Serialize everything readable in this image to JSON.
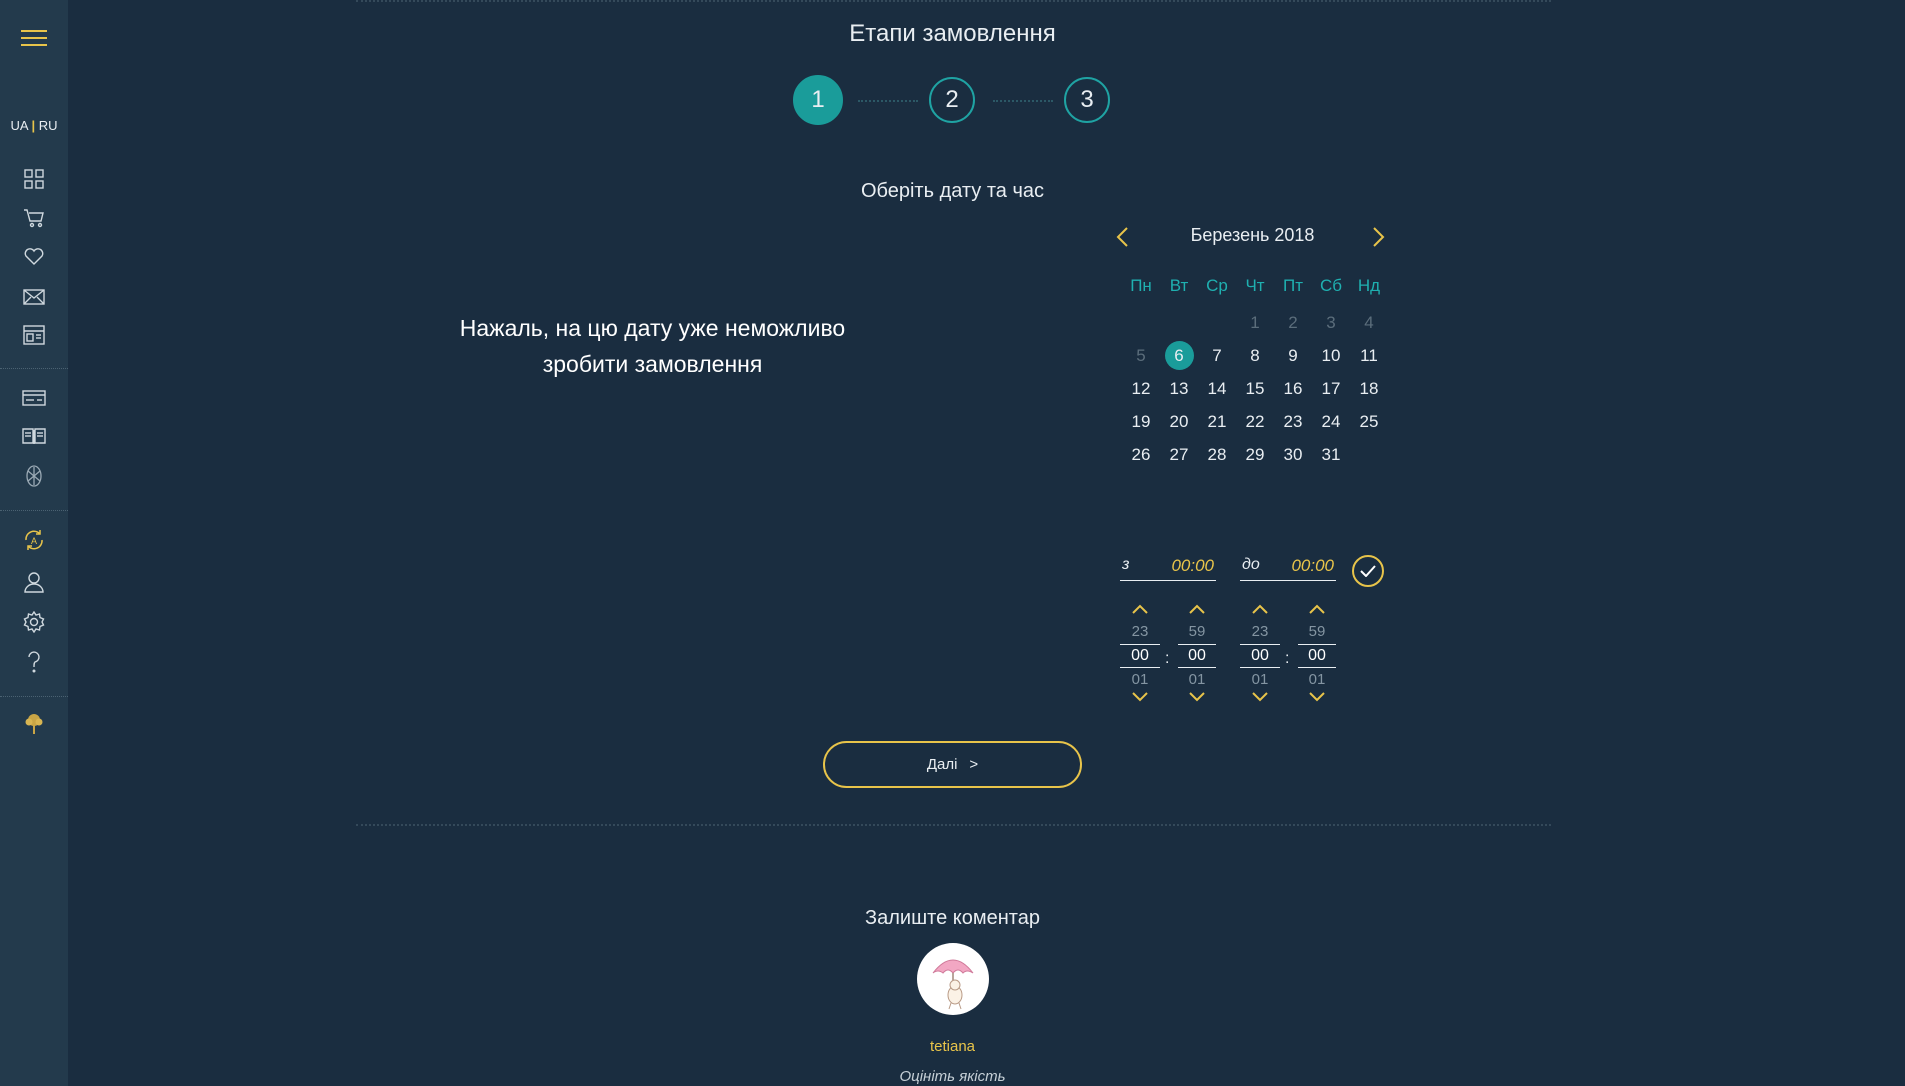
{
  "sidebar": {
    "lang_ua": "UA",
    "lang_sep": "|",
    "lang_ru": "RU",
    "icons": [
      "menu-icon",
      "grid-icon",
      "cart-icon",
      "heart-icon",
      "mail-icon",
      "layout-icon",
      "card-icon",
      "book-icon",
      "flower-icon",
      "sync-icon",
      "user-icon",
      "gear-icon",
      "help-icon",
      "tree-icon"
    ],
    "accent": "#e8c44a"
  },
  "header": {
    "title": "Етапи замовлення",
    "steps": [
      "1",
      "2",
      "3"
    ],
    "active_step": 1
  },
  "date_section": {
    "title": "Оберіть дату та час",
    "notice": "Нажаль, на цю дату уже неможливо зробити замовлення"
  },
  "calendar": {
    "month_label": "Березень 2018",
    "weekdays": [
      "Пн",
      "Вт",
      "Ср",
      "Чт",
      "Пт",
      "Сб",
      "Нд"
    ],
    "rows": [
      [
        "",
        "",
        "",
        "1",
        "2",
        "3",
        "4"
      ],
      [
        "5",
        "6",
        "7",
        "8",
        "9",
        "10",
        "11"
      ],
      [
        "12",
        "13",
        "14",
        "15",
        "16",
        "17",
        "18"
      ],
      [
        "19",
        "20",
        "21",
        "22",
        "23",
        "24",
        "25"
      ],
      [
        "26",
        "27",
        "28",
        "29",
        "30",
        "31",
        ""
      ]
    ],
    "selected_day": "6",
    "teal": "#1a9c9a"
  },
  "time": {
    "from_label": "з",
    "from_value": "00:00",
    "to_label": "до",
    "to_value": "00:00",
    "from_hours": {
      "prev": "23",
      "cur": "00",
      "next": "01"
    },
    "from_minutes": {
      "prev": "59",
      "cur": "00",
      "next": "01"
    },
    "to_hours": {
      "prev": "23",
      "cur": "00",
      "next": "01"
    },
    "to_minutes": {
      "prev": "59",
      "cur": "00",
      "next": "01"
    },
    "separator": ":"
  },
  "next_button": {
    "label": "Далі",
    "arrow": ">"
  },
  "comment": {
    "title": "Залиште коментар",
    "username": "tetiana",
    "rate_label": "Оцініть якість"
  }
}
